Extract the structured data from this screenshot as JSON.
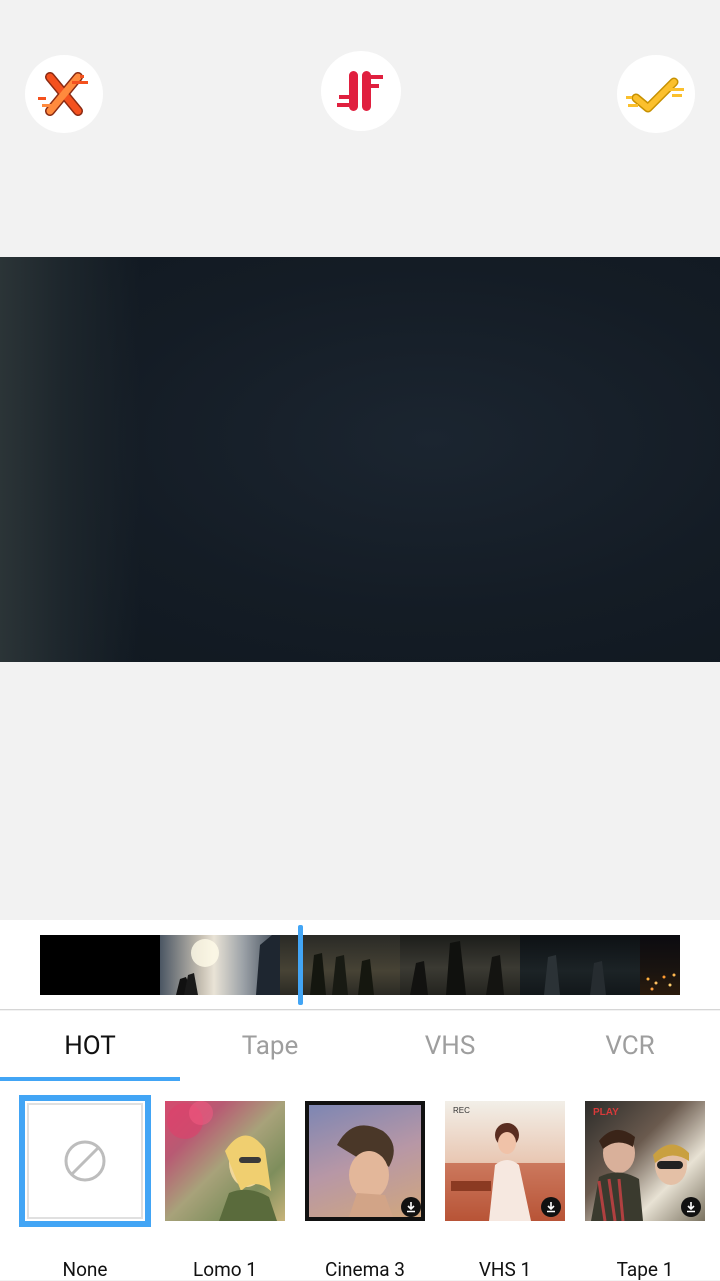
{
  "toolbar": {
    "close_icon": "close-x-icon",
    "compare_icon": "compare-icon",
    "confirm_icon": "checkmark-icon",
    "close_color": "#f4511e",
    "compare_color": "#e0203f",
    "confirm_color": "#fbc02d"
  },
  "accent_color": "#42a5f5",
  "tabs": [
    {
      "label": "HOT",
      "active": true
    },
    {
      "label": "Tape",
      "active": false
    },
    {
      "label": "VHS",
      "active": false
    },
    {
      "label": "VCR",
      "active": false
    }
  ],
  "filters": [
    {
      "label": "None",
      "selected": true,
      "icon": "none-icon"
    },
    {
      "label": "Lomo 1",
      "selected": false
    },
    {
      "label": "Cinema 3",
      "selected": false,
      "icon": "download-icon"
    },
    {
      "label": "VHS 1",
      "selected": false,
      "icon": "download-icon"
    },
    {
      "label": "Tape 1",
      "selected": false,
      "icon": "download-icon"
    }
  ]
}
